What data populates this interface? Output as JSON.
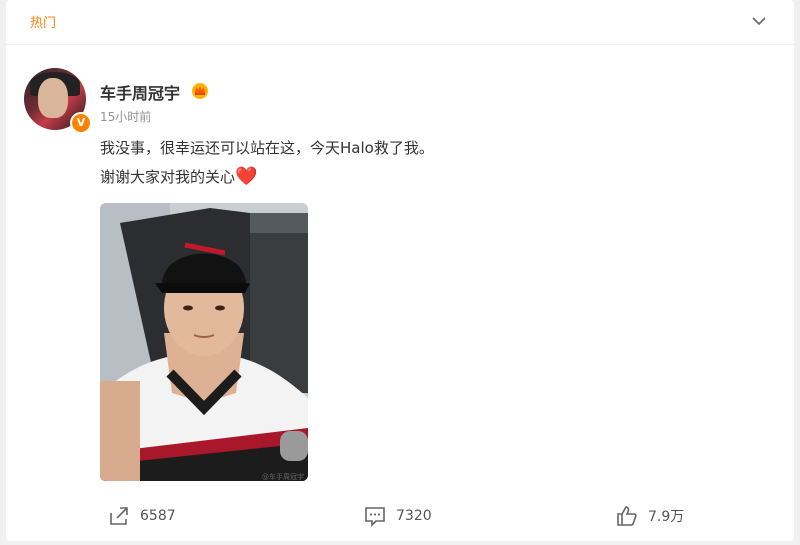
{
  "header": {
    "hot_label": "热门"
  },
  "post": {
    "username": "车手周冠宇",
    "verified_badge": "V",
    "time": "15小时前",
    "text_line1": "我没事，很幸运还可以站在这，今天Halo救了我。",
    "text_line2": "谢谢大家对我的关心",
    "heart_emoji": "❤️",
    "watermark": "@车手周冠宇"
  },
  "actions": {
    "forward_count": "6587",
    "comment_count": "7320",
    "like_count": "7.9万"
  },
  "colors": {
    "accent": "#ff8200",
    "text": "#333333",
    "muted": "#939393",
    "heart": "#e0202f"
  },
  "icons": {
    "chevron": "chevron-down-icon",
    "crown": "crown-icon",
    "forward": "forward-icon",
    "comment": "comment-icon",
    "like": "thumbs-up-icon"
  }
}
